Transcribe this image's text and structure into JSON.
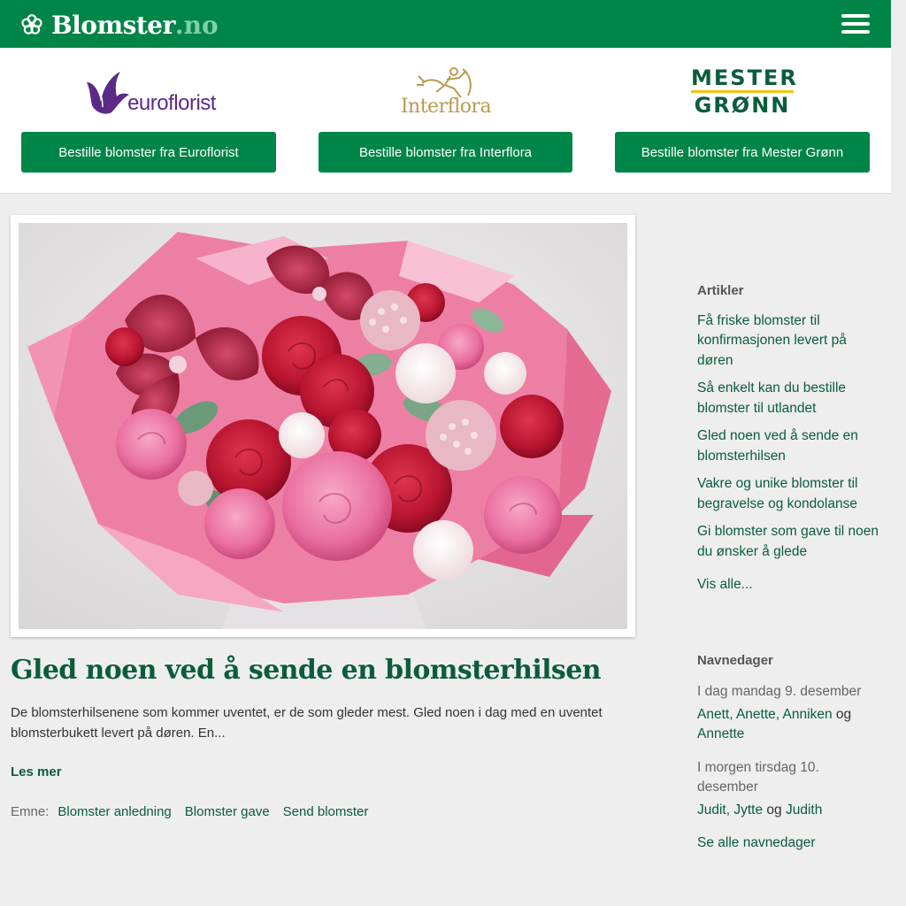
{
  "header": {
    "brand_name": "Blomster",
    "brand_tld": ".no",
    "logo_icon": "flower-icon",
    "menu_icon": "hamburger-icon",
    "bg_color": "#008548"
  },
  "partners": [
    {
      "logo_text": "euroflorist",
      "button_label": "Bestille blomster fra Euroflorist"
    },
    {
      "logo_text": "Interflora",
      "button_label": "Bestille blomster fra Interflora"
    },
    {
      "logo_text_line1": "MESTER",
      "logo_text_line2": "GRØNN",
      "button_label": "Bestille blomster fra Mester Grønn"
    }
  ],
  "article": {
    "title": "Gled noen ved å sende en blomsterhilsen",
    "excerpt": "De blomsterhilsenene som kommer uventet, er de som gleder mest. Gled noen i dag med en uventet blomsterbukett levert på døren. En...",
    "read_more": "Les mer",
    "topics_label": "Emne:",
    "topics": [
      "Blomster anledning",
      "Blomster gave",
      "Send blomster"
    ]
  },
  "sidebar": {
    "articles_heading": "Artikler",
    "articles": [
      "Få friske blomster til konfirmasjonen levert på døren",
      "Så enkelt kan du bestille blomster til utlandet",
      "Gled noen ved å sende en blomsterhilsen",
      "Vakre og unike blomster til begravelse og kondolanse",
      "Gi blomster som gave til noen du ønsker å glede"
    ],
    "see_all": "Vis alle...",
    "namedays_heading": "Navnedager",
    "today_label": "I dag mandag 9. desember",
    "today_names": [
      "Anett",
      "Anette",
      "Anniken",
      "Annette"
    ],
    "tomorrow_label": "I morgen tirsdag 10. desember",
    "tomorrow_names": [
      "Judit",
      "Jytte",
      "Judith"
    ],
    "and_word": "og",
    "see_all_namedays": "Se alle navnedager"
  }
}
